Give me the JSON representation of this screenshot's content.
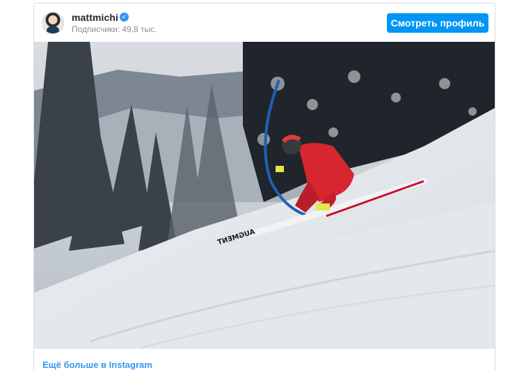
{
  "profile": {
    "username": "mattmichi",
    "followers_label": "Подписчики:",
    "followers_count": "49,8 тыс.",
    "verified": true,
    "view_profile_label": "Смотреть профиль"
  },
  "post": {
    "ski_brand_text": "AUGMENT"
  },
  "footer": {
    "more_link_label": "Ещё больше в Instagram"
  },
  "colors": {
    "button": "#0095f6",
    "link": "#3897f0",
    "text_primary": "#262626",
    "text_secondary": "#8e8e8e",
    "border": "#dbdbdb"
  }
}
